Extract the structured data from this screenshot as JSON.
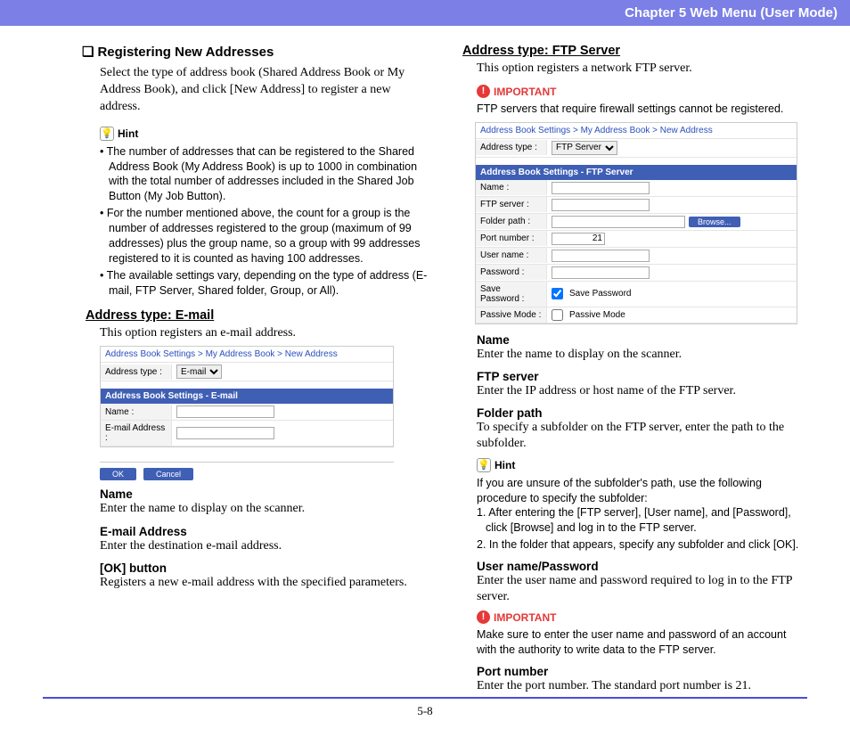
{
  "header": "Chapter 5   Web Menu (User Mode)",
  "footer": "5-8",
  "left": {
    "h1_prefix": "❏",
    "h1": "Registering New Addresses",
    "intro": "Select the type of address book (Shared Address Book or My Address Book), and click [New Address] to register a new address.",
    "hint_label": "Hint",
    "hints": [
      "The number of addresses that can be registered to the Shared Address Book (My Address Book) is up to 1000 in combination with the total number of addresses included in the Shared Job Button (My Job Button).",
      "For the number mentioned above, the count for a group is the number of addresses registered to the group (maximum of 99 addresses) plus the group name, so a group with 99 addresses registered to it is counted as having 100 addresses.",
      "The available settings vary, depending on the type of address (E-mail, FTP Server, Shared folder, Group, or All)."
    ],
    "h2": "Address type: E-mail",
    "lead": "This option registers an e-mail address.",
    "shot": {
      "crumb": "Address Book Settings > My Address Book > New Address",
      "addrtype_label": "Address type :",
      "addrtype_value": "E-mail",
      "band": "Address Book Settings - E-mail",
      "name_label": "Name :",
      "email_label": "E-mail Address :",
      "ok": "OK",
      "cancel": "Cancel"
    },
    "f1": {
      "name": "Name",
      "desc": "Enter the name to display on the scanner."
    },
    "f2": {
      "name": "E-mail Address",
      "desc": "Enter the destination e-mail address."
    },
    "f3": {
      "name": "[OK] button",
      "desc": "Registers a new e-mail address with the specified parameters."
    }
  },
  "right": {
    "h2": "Address type: FTP Server",
    "lead": "This option registers a network FTP server.",
    "important_label": "IMPORTANT",
    "important_text1": "FTP servers that require firewall settings cannot be registered.",
    "shot": {
      "crumb": "Address Book Settings > My Address Book > New Address",
      "addrtype_label": "Address type :",
      "addrtype_value": "FTP Server",
      "band": "Address Book Settings - FTP Server",
      "name_label": "Name :",
      "server_label": "FTP server :",
      "folder_label": "Folder path :",
      "browse": "Browse...",
      "port_label": "Port number :",
      "port_value": "21",
      "user_label": "User name :",
      "pass_label": "Password :",
      "savepass_label": "Save Password :",
      "savepass_text": "Save Password",
      "passive_label": "Passive Mode :",
      "passive_text": "Passive Mode"
    },
    "f1": {
      "name": "Name",
      "desc": "Enter the name to display on the scanner."
    },
    "f2": {
      "name": "FTP server",
      "desc": "Enter the IP address or host name of the FTP server."
    },
    "f3": {
      "name": "Folder path",
      "desc": "To specify a subfolder on the FTP server, enter the path to the subfolder."
    },
    "hint_label": "Hint",
    "hint_text": "If you are unsure of the subfolder's path, use the following procedure to specify the subfolder:",
    "hint_steps": [
      "After entering the [FTP server], [User name], and [Password], click [Browse] and log in to the FTP server.",
      "In the folder that appears, specify any subfolder and click [OK]."
    ],
    "f4": {
      "name": "User name/Password",
      "desc": "Enter the user name and password required to log in to the FTP server."
    },
    "important_text2": "Make sure to enter the user name and password of an account with the authority to write data to the FTP server.",
    "f5": {
      "name": "Port number",
      "desc": "Enter the port number. The standard port number is 21."
    }
  }
}
